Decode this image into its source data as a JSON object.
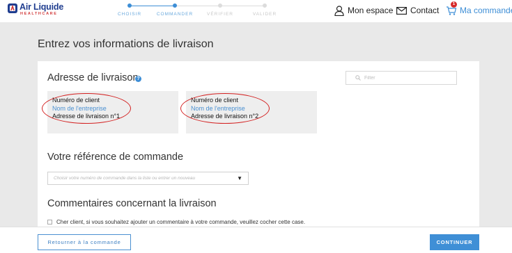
{
  "brand": {
    "name": "Air Liquide",
    "subtitle": "HEALTHCARE"
  },
  "steps": [
    {
      "label": "CHOISIR",
      "state": "done"
    },
    {
      "label": "COMMANDER",
      "state": "current"
    },
    {
      "label": "VÉRIFIER",
      "state": "todo"
    },
    {
      "label": "VALIDER",
      "state": "todo"
    }
  ],
  "nav": {
    "account": "Mon espace",
    "contact": "Contact",
    "cart": "Ma commande",
    "cart_count": "1"
  },
  "page": {
    "title": "Entrez vos informations de livraison"
  },
  "delivery": {
    "title": "Adresse de livraison",
    "help_icon": "?",
    "filter_placeholder": "Filter",
    "addresses": [
      {
        "client": "Numéro de client",
        "company": "Nom de l'entreprise",
        "address": "Adresse de livraison n°1"
      },
      {
        "client": "Numéro de client",
        "company": "Nom de l'entreprise",
        "address": "Adresse de livraison n°2"
      }
    ]
  },
  "reference": {
    "title": "Votre référence de commande",
    "placeholder": "Choisir votre numéro de commande dans la liste ou entrer un nouveau",
    "arrow": "▼"
  },
  "comments": {
    "title": "Commentaires concernant la livraison",
    "checkbox_label": "Cher client, si vous souhaitez ajouter un commentaire à votre commande, veuillez cocher cette case.",
    "checked": false
  },
  "footer": {
    "back_label": "Retourner à la commande",
    "continue_label": "CONTINUER"
  },
  "colors": {
    "accent": "#3d8ed6",
    "annotation": "#d31f1f",
    "background": "#e9e9e9"
  }
}
